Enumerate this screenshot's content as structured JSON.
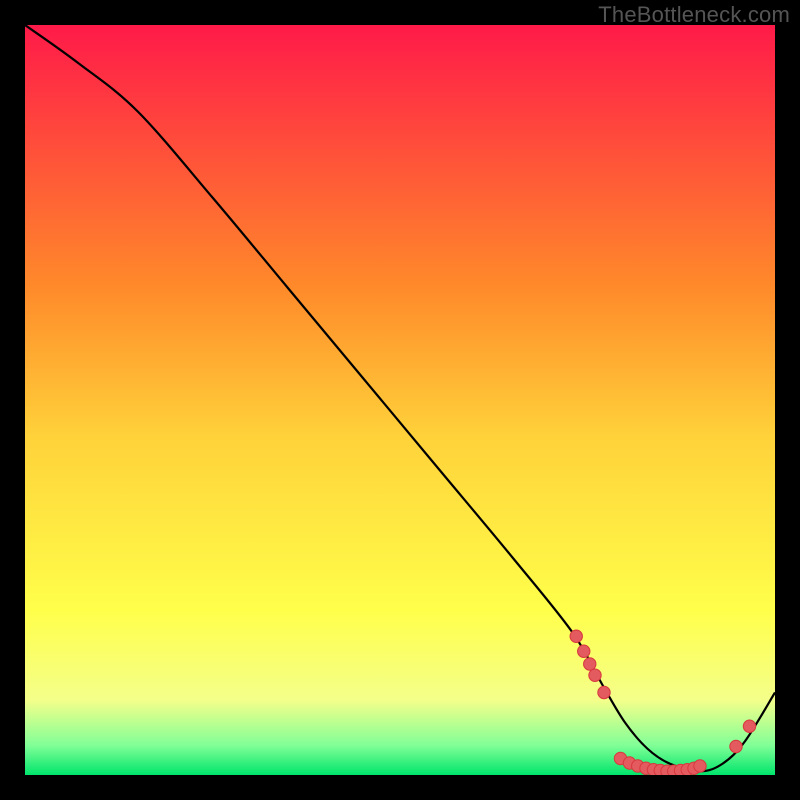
{
  "watermark": "TheBottleneck.com",
  "colors": {
    "bg": "#000000",
    "grad_top": "#ff1a49",
    "grad_mid_upper": "#ff8a2a",
    "grad_mid": "#ffd23a",
    "grad_mid_lower": "#ffff4a",
    "grad_low": "#f4ff8a",
    "grad_green1": "#82ff97",
    "grad_green2": "#00e56c",
    "curve": "#000000",
    "dot_fill": "#e35a5f",
    "dot_stroke": "#d8383d"
  },
  "chart_data": {
    "type": "line",
    "title": "",
    "xlabel": "",
    "ylabel": "",
    "xlim": [
      0,
      100
    ],
    "ylim": [
      0,
      100
    ],
    "series": [
      {
        "name": "bottleneck-curve",
        "x": [
          0,
          7,
          15,
          25,
          35,
          45,
          55,
          65,
          73,
          77,
          80,
          83,
          86,
          90,
          93,
          96,
          100
        ],
        "y": [
          100,
          95,
          88.5,
          77,
          65,
          53,
          41,
          29,
          19,
          12,
          7,
          3.5,
          1.5,
          0.5,
          1.5,
          4.5,
          11
        ]
      }
    ],
    "dots": [
      {
        "x": 73.5,
        "y": 18.5
      },
      {
        "x": 74.5,
        "y": 16.5
      },
      {
        "x": 75.3,
        "y": 14.8
      },
      {
        "x": 76.0,
        "y": 13.3
      },
      {
        "x": 77.2,
        "y": 11.0
      },
      {
        "x": 79.4,
        "y": 2.2
      },
      {
        "x": 80.6,
        "y": 1.6
      },
      {
        "x": 81.7,
        "y": 1.2
      },
      {
        "x": 82.8,
        "y": 0.9
      },
      {
        "x": 83.8,
        "y": 0.7
      },
      {
        "x": 84.7,
        "y": 0.6
      },
      {
        "x": 85.6,
        "y": 0.5
      },
      {
        "x": 86.5,
        "y": 0.5
      },
      {
        "x": 87.4,
        "y": 0.6
      },
      {
        "x": 88.3,
        "y": 0.7
      },
      {
        "x": 89.2,
        "y": 0.9
      },
      {
        "x": 90.0,
        "y": 1.2
      },
      {
        "x": 94.8,
        "y": 3.8
      },
      {
        "x": 96.6,
        "y": 6.5
      }
    ],
    "gradient_stops": [
      {
        "offset": 0,
        "key": "grad_top"
      },
      {
        "offset": 35,
        "key": "grad_mid_upper"
      },
      {
        "offset": 55,
        "key": "grad_mid"
      },
      {
        "offset": 78,
        "key": "grad_mid_lower"
      },
      {
        "offset": 90,
        "key": "grad_low"
      },
      {
        "offset": 96,
        "key": "grad_green1"
      },
      {
        "offset": 100,
        "key": "grad_green2"
      }
    ]
  }
}
